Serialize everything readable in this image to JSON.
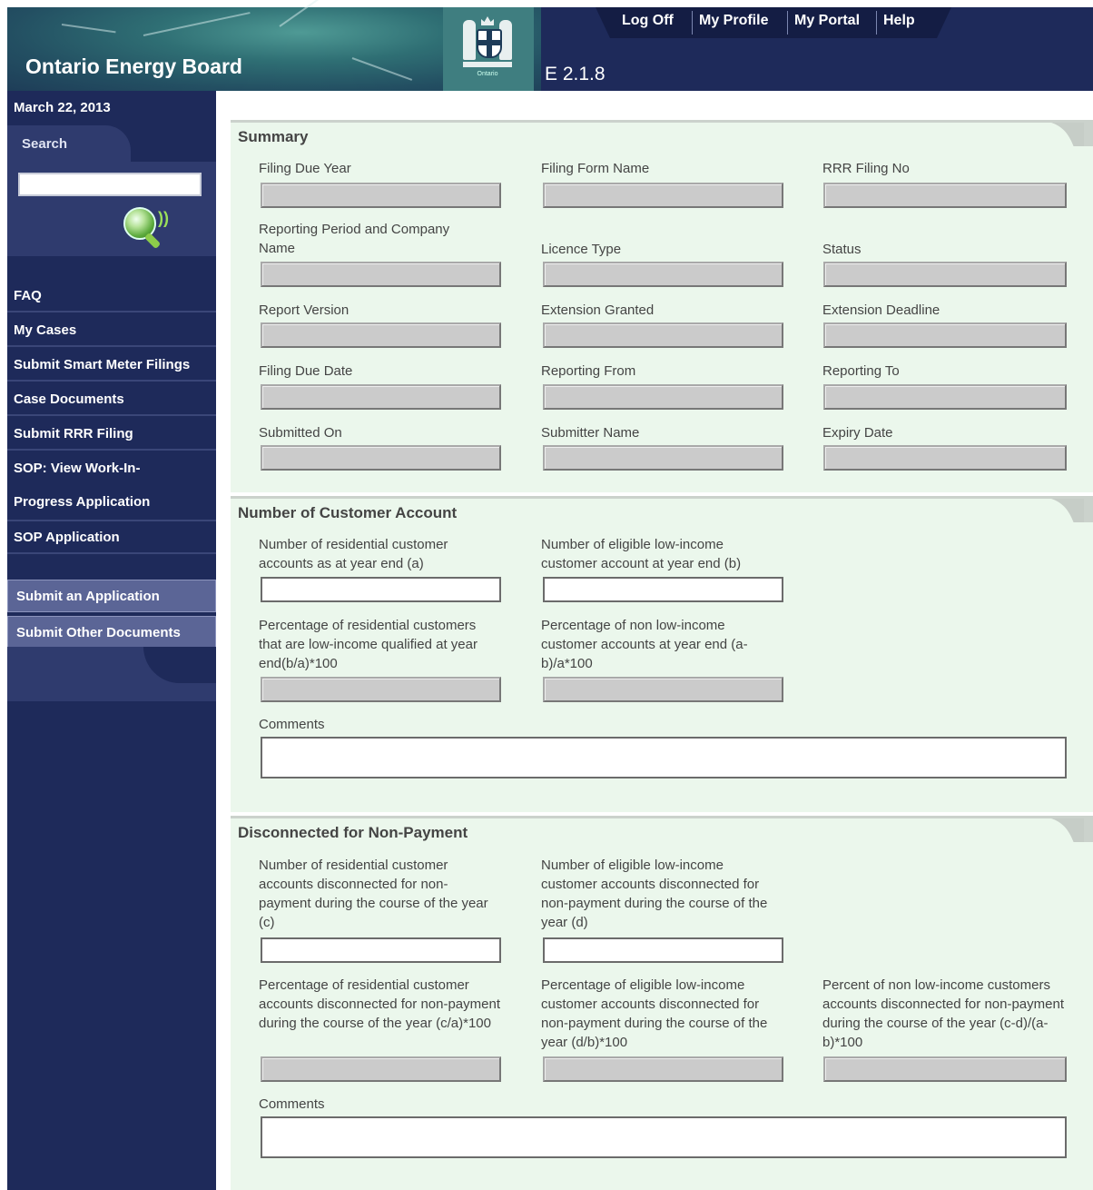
{
  "header": {
    "app_title": "Ontario Energy Board",
    "crest_label": "Ontario",
    "version": "E 2.1.8",
    "nav": [
      "Log Off",
      "My Profile",
      "My Portal",
      "Help"
    ]
  },
  "sidebar": {
    "date": "March 22, 2013",
    "search_label": "Search",
    "search_value": "",
    "items": [
      "FAQ",
      "My Cases",
      "Submit Smart Meter Filings",
      "Case Documents",
      "Submit RRR Filing",
      "SOP: View Work-In-",
      "Progress Application",
      "SOP Application"
    ],
    "buttons": [
      "Submit an Application",
      "Submit Other Documents"
    ]
  },
  "summary": {
    "title": "Summary",
    "fields": [
      {
        "label": "Filing Due Year",
        "value": ""
      },
      {
        "label": "Filing Form Name",
        "value": ""
      },
      {
        "label": "RRR Filing No",
        "value": ""
      },
      {
        "label": "Reporting Period and Company Name",
        "value": ""
      },
      {
        "label": "Licence Type",
        "value": ""
      },
      {
        "label": "Status",
        "value": ""
      },
      {
        "label": "Report Version",
        "value": ""
      },
      {
        "label": "Extension Granted",
        "value": ""
      },
      {
        "label": "Extension Deadline",
        "value": ""
      },
      {
        "label": "Filing Due Date",
        "value": ""
      },
      {
        "label": "Reporting From",
        "value": ""
      },
      {
        "label": "Reporting To",
        "value": ""
      },
      {
        "label": "Submitted On",
        "value": ""
      },
      {
        "label": "Submitter Name",
        "value": ""
      },
      {
        "label": "Expiry Date",
        "value": ""
      }
    ]
  },
  "customer_account": {
    "title": "Number of Customer Account",
    "fields": [
      {
        "label": "Number of residential customer accounts as at year end (a)",
        "value": ""
      },
      {
        "label": "Number of eligible low-income customer account at year end (b)",
        "value": ""
      },
      {
        "label": "Percentage of residential customers that are low-income qualified at year end(b/a)*100",
        "value": ""
      },
      {
        "label": "Percentage of non low-income customer accounts at year end (a-b)/a*100",
        "value": ""
      }
    ],
    "comments_label": "Comments",
    "comments_value": ""
  },
  "disconnected": {
    "title": "Disconnected for Non-Payment",
    "fields": [
      {
        "label": "Number of residential customer accounts disconnected for non-payment during the course of the year (c)",
        "value": ""
      },
      {
        "label": "Number of eligible low-income customer accounts disconnected for non-payment during the course of the year (d)",
        "value": ""
      },
      {
        "label": "Percentage of residential customer accounts disconnected for non-payment during the course of the year (c/a)*100",
        "value": ""
      },
      {
        "label": "Percentage of eligible low-income customer accounts disconnected for non-payment during the course of the year (d/b)*100",
        "value": ""
      },
      {
        "label": "Percent of non low-income customers accounts disconnected for non-payment during the course of the year (c-d)/(a-b)*100",
        "value": ""
      }
    ],
    "comments_label": "Comments",
    "comments_value": ""
  }
}
